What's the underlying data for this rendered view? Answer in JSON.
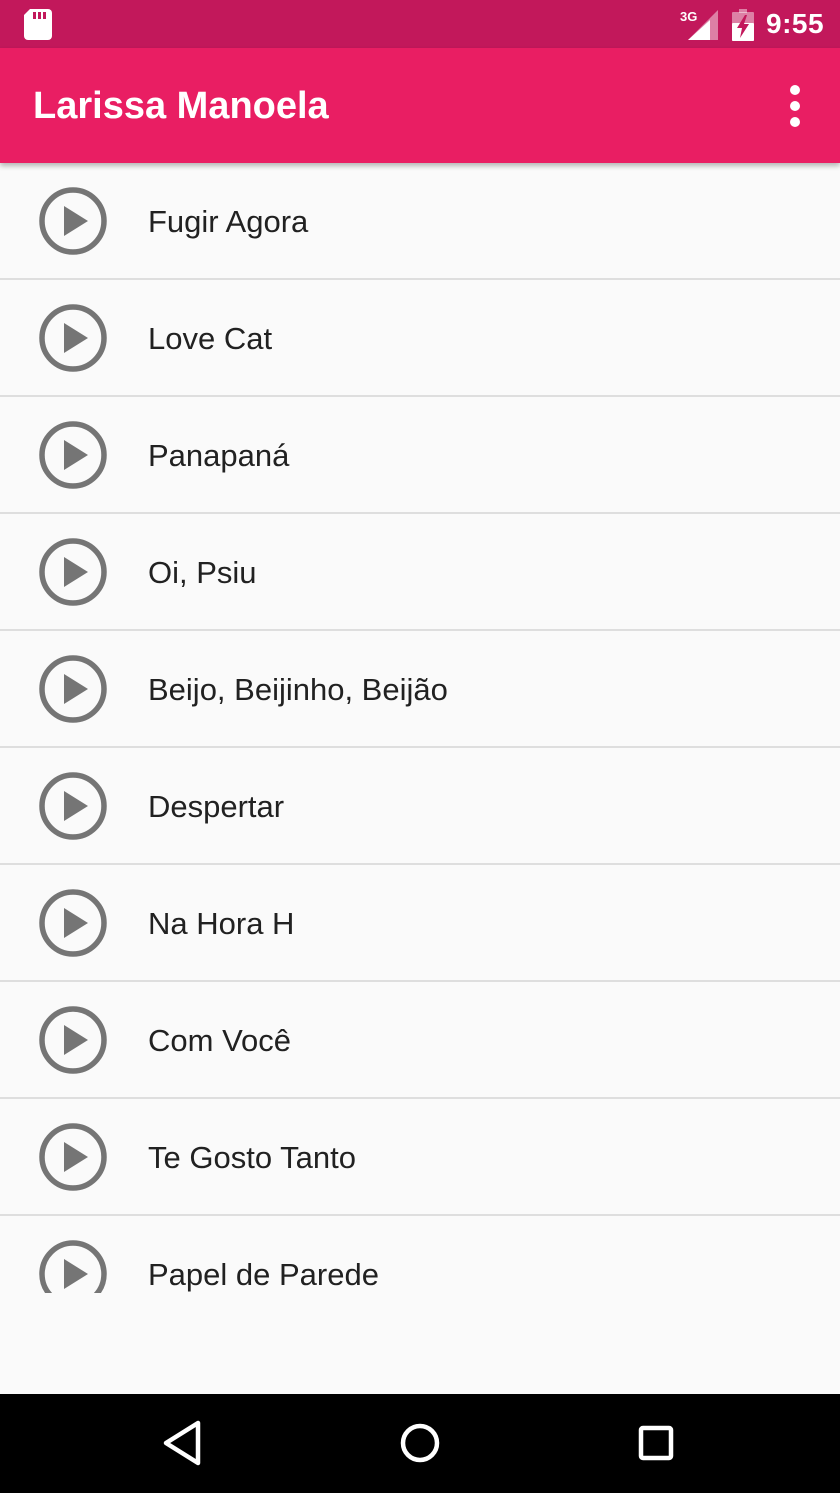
{
  "status_bar": {
    "time": "9:55",
    "network_label": "3G",
    "icons": [
      "sd-card-icon",
      "signal-3g-icon",
      "battery-icon"
    ],
    "background_color": "#c2185b"
  },
  "toolbar": {
    "title": "Larissa Manoela",
    "background_color": "#e91e63",
    "overflow_icon": "more-vert-icon"
  },
  "songs": [
    {
      "title": "Fugir Agora"
    },
    {
      "title": "Love Cat"
    },
    {
      "title": "Panapaná"
    },
    {
      "title": "Oi, Psiu"
    },
    {
      "title": "Beijo, Beijinho, Beijão"
    },
    {
      "title": "Despertar"
    },
    {
      "title": "Na Hora H"
    },
    {
      "title": "Com Você"
    },
    {
      "title": "Te Gosto Tanto"
    },
    {
      "title": "Papel de Parede"
    }
  ],
  "row_icon": "play-circle-icon",
  "nav_bar": {
    "buttons": [
      "back-icon",
      "home-icon",
      "recents-icon"
    ]
  }
}
